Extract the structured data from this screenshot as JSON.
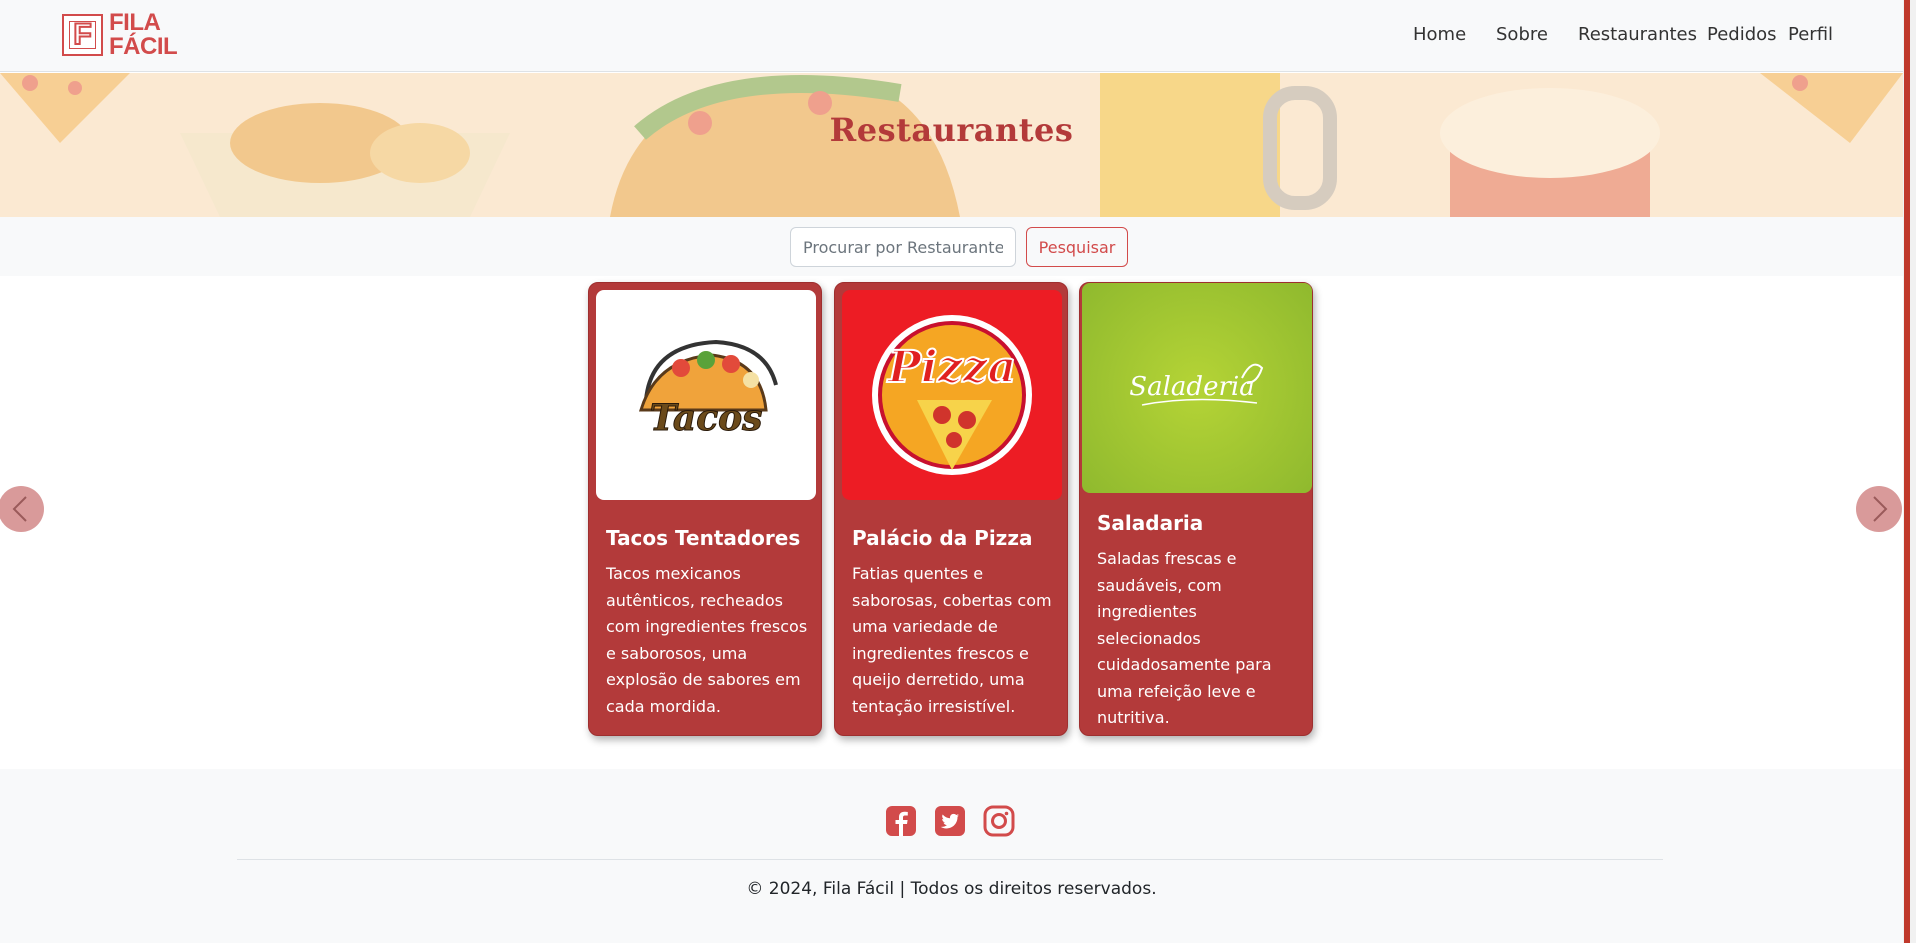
{
  "brand": {
    "line1": "FILA",
    "line2": "FÁCIL",
    "mark": "F",
    "color": "#d24b4b"
  },
  "nav": {
    "items": [
      {
        "label": "Home"
      },
      {
        "label": "Sobre"
      },
      {
        "label": "Restaurantes"
      },
      {
        "label": "Pedidos"
      },
      {
        "label": "Perfil"
      }
    ]
  },
  "hero": {
    "title": "Restaurantes"
  },
  "search": {
    "placeholder": "Procurar por Restaurante",
    "button_label": "Pesquisar"
  },
  "carousel": {
    "prev_icon": "chevron-left-icon",
    "next_icon": "chevron-right-icon",
    "cards": [
      {
        "title": "Tacos Tentadores",
        "text": "Tacos mexicanos autênticos, recheados com ingredientes frescos e saborosos, uma explosão de sabores em cada mordida.",
        "logo_text": "Tacos",
        "logo": "tacos-logo"
      },
      {
        "title": "Palácio da Pizza",
        "text": "Fatias quentes e saborosas, cobertas com uma variedade de ingredientes frescos e queijo derretido, uma tentação irresistível.",
        "logo_text": "Pizza",
        "logo": "pizza-logo"
      },
      {
        "title": "Saladaria",
        "text": "Saladas frescas e saudáveis, com ingredientes selecionados cuidadosamente para uma refeição leve e nutritiva.",
        "logo_text": "Saladeria",
        "logo": "saladeria-logo"
      }
    ]
  },
  "footer": {
    "social": [
      "facebook-icon",
      "twitter-icon",
      "instagram-icon"
    ],
    "copyright": "© 2024, Fila Fácil | Todos os direitos reservados."
  },
  "colors": {
    "accent": "#d24b4b",
    "card": "#b33a3a",
    "pizza_bg": "#ed1c24",
    "salad_bg": "#9bc53d"
  }
}
